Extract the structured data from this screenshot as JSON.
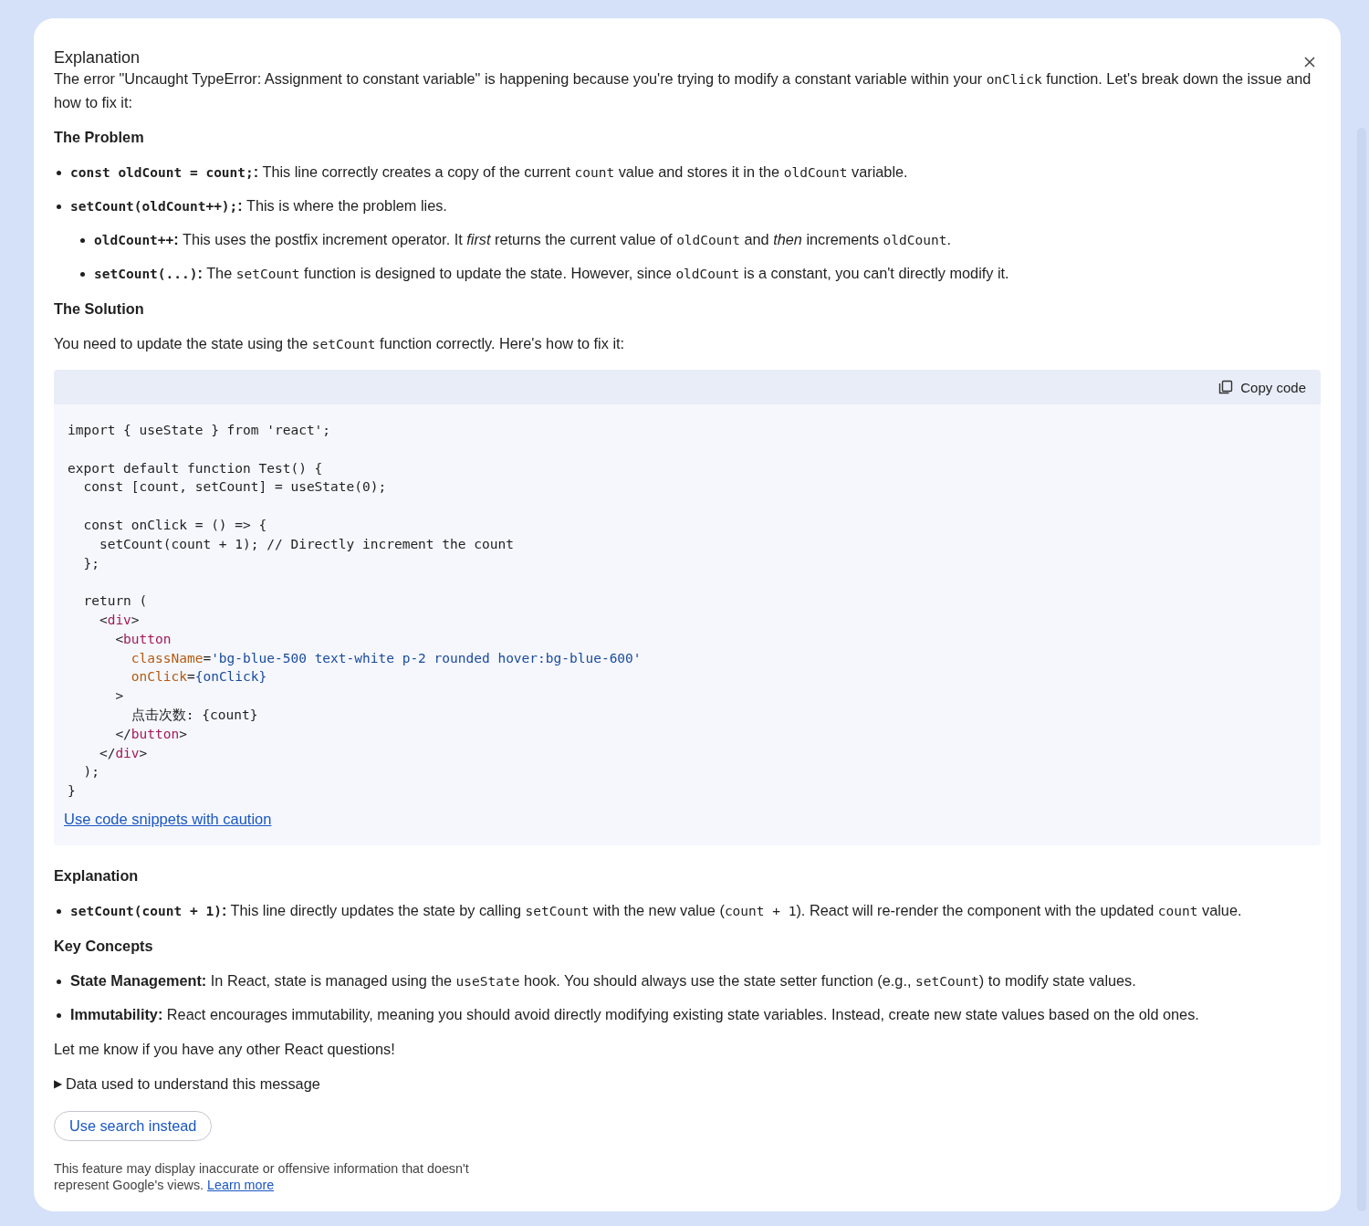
{
  "panel": {
    "title": "Explanation",
    "blocks": [
      {
        "kind": "paragraph",
        "segments": [
          {
            "kind": "text",
            "text": "The error \"Uncaught TypeError: Assignment to constant variable\" is happening because you're trying to modify a constant variable within your "
          },
          {
            "kind": "code",
            "text": "onClick"
          },
          {
            "kind": "text",
            "text": " function. Let's break down the issue and how to fix it:"
          }
        ]
      },
      {
        "kind": "heading",
        "text": "The Problem"
      },
      {
        "kind": "bullets",
        "items": [
          {
            "segments": [
              {
                "kind": "bold_code",
                "text": "const oldCount = count;"
              },
              {
                "kind": "bold",
                "text": ":"
              },
              {
                "kind": "text",
                "text": " This line correctly creates a copy of the current "
              },
              {
                "kind": "code",
                "text": "count"
              },
              {
                "kind": "text",
                "text": " value and stores it in the "
              },
              {
                "kind": "code",
                "text": "oldCount"
              },
              {
                "kind": "text",
                "text": " variable."
              }
            ]
          },
          {
            "segments": [
              {
                "kind": "bold_code",
                "text": "setCount(oldCount++);"
              },
              {
                "kind": "bold",
                "text": ":"
              },
              {
                "kind": "text",
                "text": " This is where the problem lies."
              }
            ],
            "children": [
              {
                "segments": [
                  {
                    "kind": "bold_code",
                    "text": "oldCount++"
                  },
                  {
                    "kind": "bold",
                    "text": ":"
                  },
                  {
                    "kind": "text",
                    "text": " This uses the postfix increment operator. It "
                  },
                  {
                    "kind": "italic",
                    "text": "first"
                  },
                  {
                    "kind": "text",
                    "text": " returns the current value of "
                  },
                  {
                    "kind": "code",
                    "text": "oldCount"
                  },
                  {
                    "kind": "text",
                    "text": " and "
                  },
                  {
                    "kind": "italic",
                    "text": "then"
                  },
                  {
                    "kind": "text",
                    "text": " increments "
                  },
                  {
                    "kind": "code",
                    "text": "oldCount"
                  },
                  {
                    "kind": "text",
                    "text": "."
                  }
                ]
              },
              {
                "segments": [
                  {
                    "kind": "bold_code",
                    "text": "setCount(...)"
                  },
                  {
                    "kind": "bold",
                    "text": ":"
                  },
                  {
                    "kind": "text",
                    "text": " The "
                  },
                  {
                    "kind": "code",
                    "text": "setCount"
                  },
                  {
                    "kind": "text",
                    "text": " function is designed to update the state. However, since "
                  },
                  {
                    "kind": "code",
                    "text": "oldCount"
                  },
                  {
                    "kind": "text",
                    "text": " is a constant, you can't directly modify it."
                  }
                ]
              }
            ]
          }
        ]
      },
      {
        "kind": "heading",
        "text": "The Solution"
      },
      {
        "kind": "paragraph",
        "segments": [
          {
            "kind": "text",
            "text": "You need to update the state using the "
          },
          {
            "kind": "code",
            "text": "setCount"
          },
          {
            "kind": "text",
            "text": " function correctly. Here's how to fix it:"
          }
        ]
      },
      {
        "kind": "code",
        "copy_label": "Copy code",
        "caution_link": "Use code snippets with caution",
        "groups": [
          [
            [
              {
                "kind": "plain",
                "text": "import { useState } from 'react';"
              }
            ]
          ],
          [
            [
              {
                "kind": "plain",
                "text": "export default function Test() {"
              }
            ],
            [
              {
                "kind": "plain",
                "text": "  const [count, setCount] = useState(0);"
              }
            ]
          ],
          [
            [
              {
                "kind": "plain",
                "text": "  const onClick = () => {"
              }
            ],
            [
              {
                "kind": "plain",
                "text": "    setCount(count + 1); // Directly increment the count"
              }
            ],
            [
              {
                "kind": "plain",
                "text": "  };"
              }
            ]
          ],
          [
            [
              {
                "kind": "plain",
                "text": "  return ("
              }
            ],
            [
              {
                "kind": "plain",
                "text": "    <"
              },
              {
                "kind": "tag",
                "text": "div"
              },
              {
                "kind": "plain",
                "text": ">"
              }
            ],
            [
              {
                "kind": "plain",
                "text": "      <"
              },
              {
                "kind": "tag",
                "text": "button"
              }
            ],
            [
              {
                "kind": "attr",
                "text": "        className"
              },
              {
                "kind": "plain",
                "text": "="
              },
              {
                "kind": "string",
                "text": "'bg-blue-500 text-white p-2 rounded hover:bg-blue-600'"
              }
            ],
            [
              {
                "kind": "attr",
                "text": "        onClick"
              },
              {
                "kind": "plain",
                "text": "="
              },
              {
                "kind": "string",
                "text": "{onClick}"
              }
            ],
            [
              {
                "kind": "plain",
                "text": "      >"
              }
            ],
            [
              {
                "kind": "plain",
                "text": "        点击次数: {count}"
              }
            ],
            [
              {
                "kind": "plain",
                "text": "      </"
              },
              {
                "kind": "tag",
                "text": "button"
              },
              {
                "kind": "plain",
                "text": ">"
              }
            ],
            [
              {
                "kind": "plain",
                "text": "    </"
              },
              {
                "kind": "tag",
                "text": "div"
              },
              {
                "kind": "plain",
                "text": ">"
              }
            ],
            [
              {
                "kind": "plain",
                "text": "  );"
              }
            ],
            [
              {
                "kind": "plain",
                "text": "}"
              }
            ]
          ]
        ]
      },
      {
        "kind": "heading",
        "text": "Explanation"
      },
      {
        "kind": "bullets",
        "items": [
          {
            "segments": [
              {
                "kind": "bold_code",
                "text": "setCount(count + 1)"
              },
              {
                "kind": "bold",
                "text": ":"
              },
              {
                "kind": "text",
                "text": " This line directly updates the state by calling "
              },
              {
                "kind": "code",
                "text": "setCount"
              },
              {
                "kind": "text",
                "text": " with the new value ("
              },
              {
                "kind": "code",
                "text": "count + 1"
              },
              {
                "kind": "text",
                "text": "). React will re-render the component with the updated "
              },
              {
                "kind": "code",
                "text": "count"
              },
              {
                "kind": "text",
                "text": " value."
              }
            ]
          }
        ]
      },
      {
        "kind": "heading",
        "text": "Key Concepts"
      },
      {
        "kind": "bullets",
        "items": [
          {
            "segments": [
              {
                "kind": "bold",
                "text": "State Management:"
              },
              {
                "kind": "text",
                "text": " In React, state is managed using the "
              },
              {
                "kind": "code",
                "text": "useState"
              },
              {
                "kind": "text",
                "text": " hook. You should always use the state setter function (e.g., "
              },
              {
                "kind": "code",
                "text": "setCount"
              },
              {
                "kind": "text",
                "text": ") to modify state values."
              }
            ]
          },
          {
            "segments": [
              {
                "kind": "bold",
                "text": "Immutability:"
              },
              {
                "kind": "text",
                "text": " React encourages immutability, meaning you should avoid directly modifying existing state variables. Instead, create new state values based on the old ones."
              }
            ]
          }
        ]
      },
      {
        "kind": "paragraph",
        "segments": [
          {
            "kind": "text",
            "text": "Let me know if you have any other React questions!"
          }
        ]
      },
      {
        "kind": "details",
        "marker": "▶",
        "text": "Data used to understand this message",
        "expanded": false
      },
      {
        "kind": "button",
        "text": "Use search instead"
      }
    ],
    "disclaimer": {
      "text": "This feature may display inaccurate or offensive information that doesn't represent Google's views.",
      "link": "Learn more"
    }
  }
}
